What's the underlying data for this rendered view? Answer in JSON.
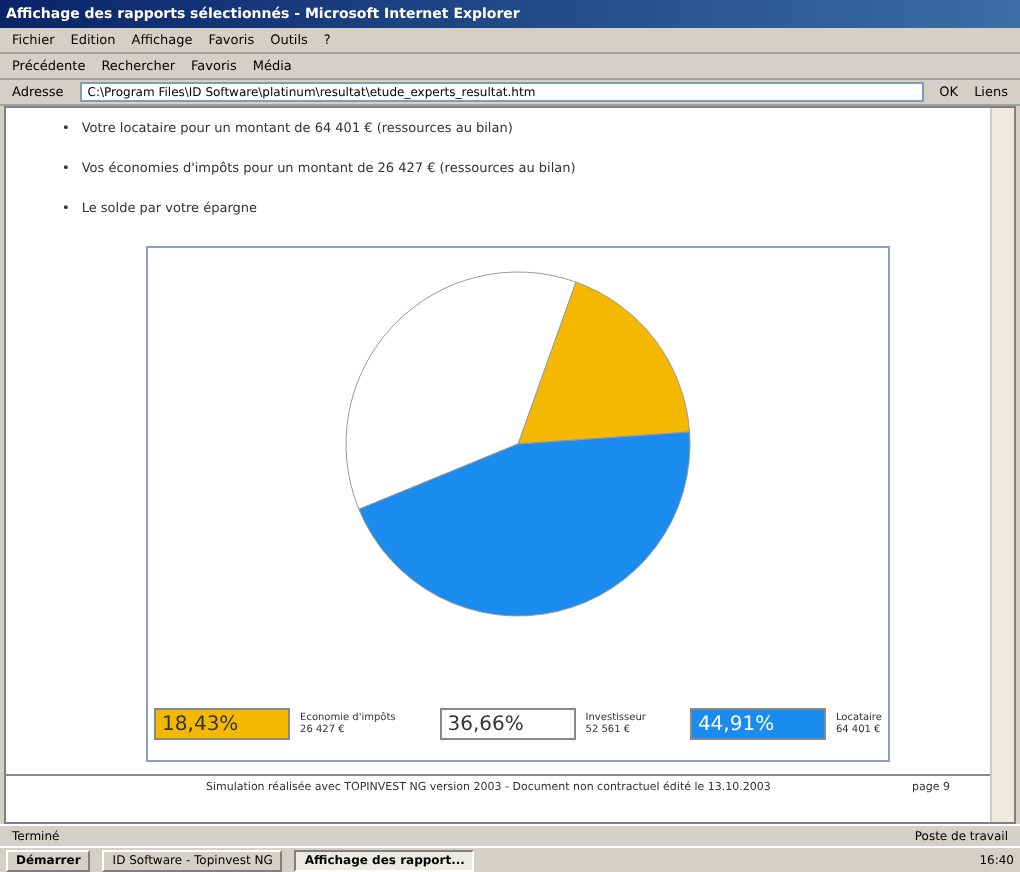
{
  "window": {
    "title": "Affichage des rapports sélectionnés - Microsoft Internet Explorer"
  },
  "menu": [
    "Fichier",
    "Edition",
    "Affichage",
    "Favoris",
    "Outils",
    "?"
  ],
  "toolbar": [
    "Précédente",
    "Rechercher",
    "Favoris",
    "Média"
  ],
  "address": {
    "label": "Adresse",
    "value": "C:\\Program Files\\ID Software\\platinum\\resultat\\etude_experts_resultat.htm",
    "go": "OK",
    "links": "Liens"
  },
  "bullet_marker": "•",
  "bullets": [
    "Votre locataire pour un montant de 64 401 € (ressources au bilan)",
    "Vos économies d'impôts pour un montant de 26 427 € (ressources au bilan)",
    "Le solde par votre épargne"
  ],
  "chart_data": {
    "type": "pie",
    "categories": [
      "Economie d'impôts",
      "Investisseur",
      "Locataire"
    ],
    "values": [
      18.43,
      36.66,
      44.91
    ]
  },
  "legend": [
    {
      "percent": "18,43%",
      "amount": "26 427 €",
      "color": "#f5b800"
    },
    {
      "percent": "36,66%",
      "amount": "52 561 €",
      "color": "#ffffff"
    },
    {
      "percent": "44,91%",
      "amount": "64 401 €",
      "color": "#1a8cf0"
    }
  ],
  "footer": {
    "text": "Simulation réalisée avec TOPINVEST NG version 2003 - Document non contractuel édité le 13.10.2003",
    "page": "page 9"
  },
  "status_bar": {
    "text": "Terminé",
    "zone": "Poste de travail"
  },
  "taskbar": {
    "start": "Démarrer",
    "tasks": [
      {
        "label": "ID Software - Topinvest NG",
        "selected": false
      },
      {
        "label": "Affichage des rapport...",
        "selected": true
      }
    ],
    "clock": "16:40"
  }
}
